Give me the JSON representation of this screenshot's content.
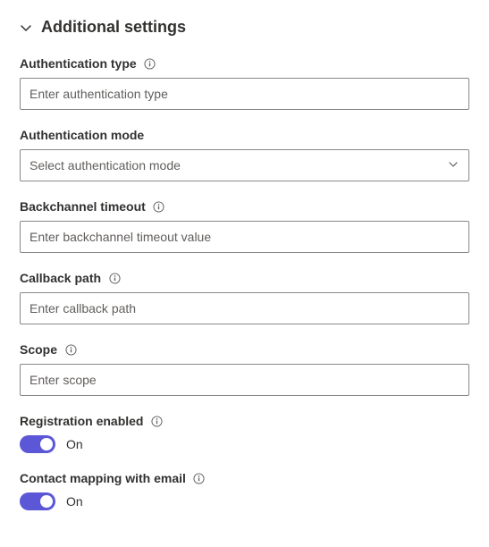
{
  "section": {
    "title": "Additional settings"
  },
  "fields": {
    "authType": {
      "label": "Authentication type",
      "placeholder": "Enter authentication type"
    },
    "authMode": {
      "label": "Authentication mode",
      "placeholder": "Select authentication mode"
    },
    "backchannelTimeout": {
      "label": "Backchannel timeout",
      "placeholder": "Enter backchannel timeout value"
    },
    "callbackPath": {
      "label": "Callback path",
      "placeholder": "Enter callback path"
    },
    "scope": {
      "label": "Scope",
      "placeholder": "Enter scope"
    },
    "registrationEnabled": {
      "label": "Registration enabled",
      "state": "On"
    },
    "contactMapping": {
      "label": "Contact mapping with email",
      "state": "On"
    }
  },
  "colors": {
    "toggleAccent": "#5b57d6",
    "border": "#8a8886",
    "text": "#323130",
    "placeholder": "#605e5c"
  }
}
